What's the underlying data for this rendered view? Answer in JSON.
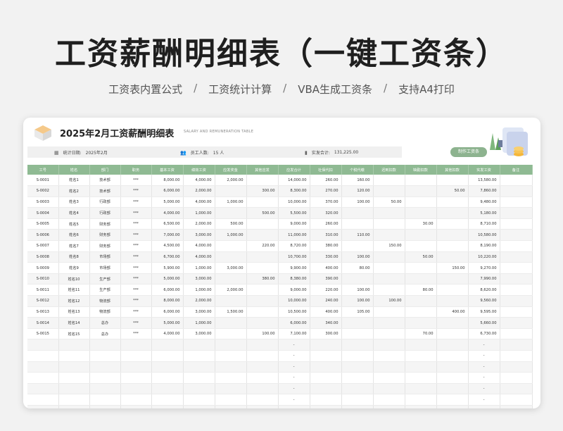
{
  "hero": {
    "title": "工资薪酬明细表（一键工资条）",
    "features": [
      "工资表内置公式",
      "工资统计计算",
      "VBA生成工资条",
      "支持A4打印"
    ],
    "separator": "/"
  },
  "sheet": {
    "title": "2025年2月工资薪酬明细表",
    "subtitle": "SALARY AND REMUNERATION TABLE",
    "info": {
      "date_label": "统计日期:",
      "date_value": "2025年2月",
      "staff_label": "员工人数:",
      "staff_value": "15 人",
      "paid_label": "实发合计:",
      "paid_value": "131,225.00"
    },
    "make_button": "制作工资条",
    "columns": [
      "工号",
      "姓名",
      "部门",
      "职务",
      "基本工资",
      "绩效工资",
      "应发奖金",
      "其他应发",
      "应发合计",
      "社保代扣",
      "个税代缴",
      "迟到扣款",
      "缺勤扣款",
      "其他扣款",
      "实发工资",
      "备注"
    ],
    "rows": [
      [
        "S-0001",
        "姓名1",
        "技术部",
        "***",
        "8,000.00",
        "4,000.00",
        "2,000.00",
        "",
        "14,000.00",
        "260.00",
        "160.00",
        "",
        "",
        "",
        "13,580.00",
        ""
      ],
      [
        "S-0002",
        "姓名2",
        "技术部",
        "***",
        "6,000.00",
        "2,000.00",
        "",
        "300.00",
        "8,300.00",
        "270.00",
        "120.00",
        "",
        "",
        "50.00",
        "7,860.00",
        ""
      ],
      [
        "S-0003",
        "姓名3",
        "行政部",
        "***",
        "5,000.00",
        "4,000.00",
        "1,000.00",
        "",
        "10,000.00",
        "370.00",
        "100.00",
        "50.00",
        "",
        "",
        "9,480.00",
        ""
      ],
      [
        "S-0004",
        "姓名4",
        "行政部",
        "***",
        "4,000.00",
        "1,000.00",
        "",
        "500.00",
        "5,500.00",
        "320.00",
        "",
        "",
        "",
        "",
        "5,180.00",
        ""
      ],
      [
        "S-0005",
        "姓名5",
        "财务部",
        "***",
        "6,500.00",
        "2,000.00",
        "500.00",
        "",
        "9,000.00",
        "260.00",
        "",
        "",
        "30.00",
        "",
        "8,710.00",
        ""
      ],
      [
        "S-0006",
        "姓名6",
        "财务部",
        "***",
        "7,000.00",
        "3,000.00",
        "1,000.00",
        "",
        "11,000.00",
        "310.00",
        "110.00",
        "",
        "",
        "",
        "10,580.00",
        ""
      ],
      [
        "S-0007",
        "姓名7",
        "财务部",
        "***",
        "4,500.00",
        "4,000.00",
        "",
        "220.00",
        "8,720.00",
        "380.00",
        "",
        "150.00",
        "",
        "",
        "8,190.00",
        ""
      ],
      [
        "S-0008",
        "姓名8",
        "市场部",
        "***",
        "6,700.00",
        "4,000.00",
        "",
        "",
        "10,700.00",
        "330.00",
        "100.00",
        "",
        "50.00",
        "",
        "10,220.00",
        ""
      ],
      [
        "S-0009",
        "姓名9",
        "市场部",
        "***",
        "5,900.00",
        "1,000.00",
        "3,000.00",
        "",
        "9,900.00",
        "400.00",
        "80.00",
        "",
        "",
        "150.00",
        "9,270.00",
        ""
      ],
      [
        "S-0010",
        "姓名10",
        "生产部",
        "***",
        "5,000.00",
        "3,000.00",
        "",
        "380.00",
        "8,380.00",
        "390.00",
        "",
        "",
        "",
        "",
        "7,990.00",
        ""
      ],
      [
        "S-0011",
        "姓名11",
        "生产部",
        "***",
        "6,000.00",
        "1,000.00",
        "2,000.00",
        "",
        "9,000.00",
        "220.00",
        "100.00",
        "",
        "80.00",
        "",
        "8,620.00",
        ""
      ],
      [
        "S-0012",
        "姓名12",
        "物流部",
        "***",
        "8,000.00",
        "2,000.00",
        "",
        "",
        "10,000.00",
        "240.00",
        "100.00",
        "100.00",
        "",
        "",
        "9,560.00",
        ""
      ],
      [
        "S-0013",
        "姓名13",
        "物流部",
        "***",
        "6,000.00",
        "3,000.00",
        "1,500.00",
        "",
        "10,500.00",
        "400.00",
        "105.00",
        "",
        "",
        "400.00",
        "9,595.00",
        ""
      ],
      [
        "S-0014",
        "姓名14",
        "总办",
        "***",
        "5,000.00",
        "1,000.00",
        "",
        "",
        "6,000.00",
        "340.00",
        "",
        "",
        "",
        "",
        "5,660.00",
        ""
      ],
      [
        "S-0015",
        "姓名15",
        "总办",
        "***",
        "4,000.00",
        "3,000.00",
        "",
        "100.00",
        "7,100.00",
        "300.00",
        "",
        "",
        "70.00",
        "",
        "6,730.00",
        ""
      ],
      [
        "",
        "",
        "",
        "",
        "",
        "",
        "",
        "",
        "-",
        "",
        "",
        "",
        "",
        "",
        "-",
        ""
      ],
      [
        "",
        "",
        "",
        "",
        "",
        "",
        "",
        "",
        "-",
        "",
        "",
        "",
        "",
        "",
        "-",
        ""
      ],
      [
        "",
        "",
        "",
        "",
        "",
        "",
        "",
        "",
        "-",
        "",
        "",
        "",
        "",
        "",
        "-",
        ""
      ],
      [
        "",
        "",
        "",
        "",
        "",
        "",
        "",
        "",
        "-",
        "",
        "",
        "",
        "",
        "",
        "-",
        ""
      ],
      [
        "",
        "",
        "",
        "",
        "",
        "",
        "",
        "",
        "-",
        "",
        "",
        "",
        "",
        "",
        "-",
        ""
      ],
      [
        "",
        "",
        "",
        "",
        "",
        "",
        "",
        "",
        "-",
        "",
        "",
        "",
        "",
        "",
        "-",
        ""
      ],
      [
        "",
        "",
        "",
        "",
        "",
        "",
        "",
        "",
        "-",
        "",
        "",
        "",
        "",
        "",
        "-",
        ""
      ]
    ]
  },
  "colors": {
    "header_green": "#8fba93",
    "button_green": "#8db38f"
  },
  "icons": [
    "calendar-icon",
    "people-icon",
    "bar-chart-icon",
    "cube-logo-icon"
  ]
}
